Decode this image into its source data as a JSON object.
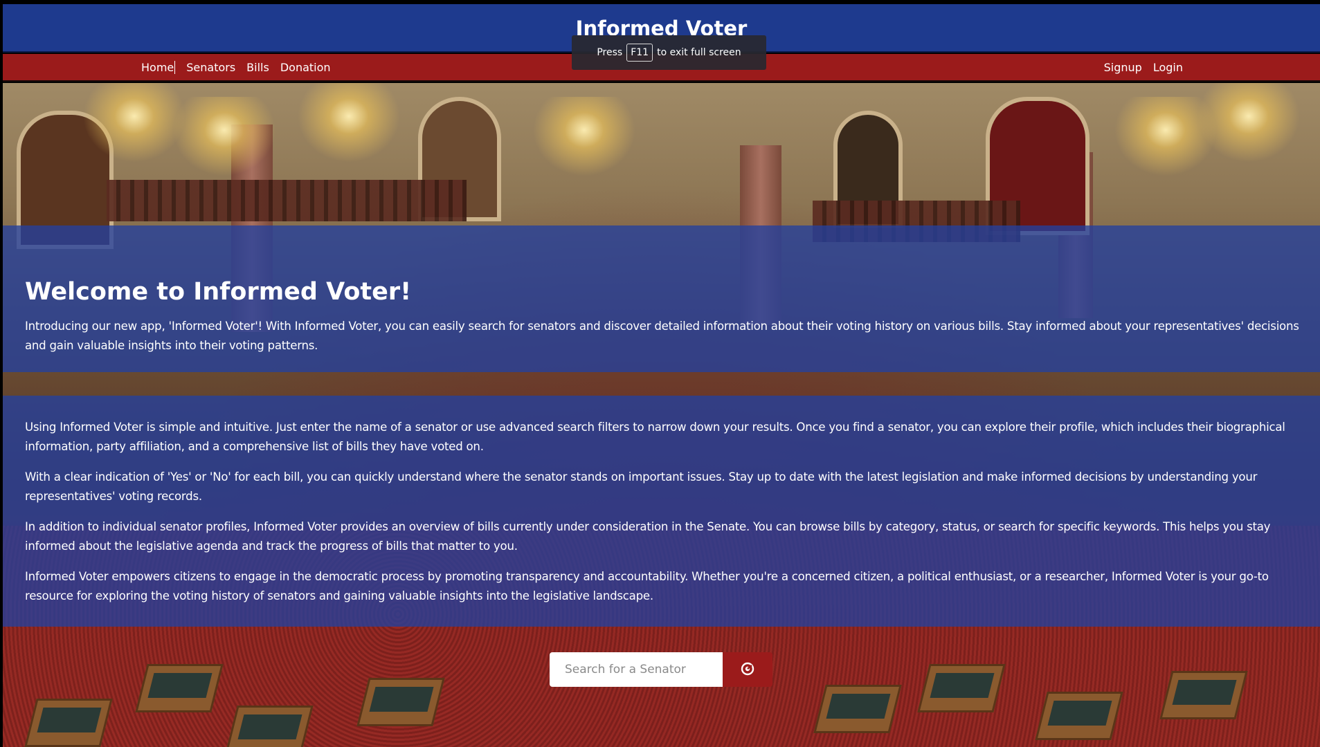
{
  "header": {
    "title": "Informed Voter"
  },
  "nav": {
    "left": [
      "Home",
      "Senators",
      "Bills",
      "Donation"
    ],
    "right": [
      "Signup",
      "Login"
    ]
  },
  "toast": {
    "prefix": "Press",
    "key": "F11",
    "suffix": "to exit full screen"
  },
  "welcome": {
    "heading": "Welcome to Informed Voter!",
    "intro": "Introducing our new app, 'Informed Voter'! With Informed Voter, you can easily search for senators and discover detailed information about their voting history on various bills. Stay informed about your representatives' decisions and gain valuable insights into their voting patterns."
  },
  "details": [
    "Using Informed Voter is simple and intuitive. Just enter the name of a senator or use advanced search filters to narrow down your results. Once you find a senator, you can explore their profile, which includes their biographical information, party affiliation, and a comprehensive list of bills they have voted on.",
    "With a clear indication of 'Yes' or 'No' for each bill, you can quickly understand where the senator stands on important issues. Stay up to date with the latest legislation and make informed decisions by understanding your representatives' voting records.",
    "In addition to individual senator profiles, Informed Voter provides an overview of bills currently under consideration in the Senate. You can browse bills by category, status, or search for specific keywords. This helps you stay informed about the legislative agenda and track the progress of bills that matter to you.",
    "Informed Voter empowers citizens to engage in the democratic process by promoting transparency and accountability. Whether you're a concerned citizen, a political enthusiast, or a researcher, Informed Voter is your go-to resource for exploring the voting history of senators and gaining valuable insights into the legislative landscape."
  ],
  "search": {
    "placeholder": "Search for a Senator",
    "icon": "search-icon"
  },
  "colors": {
    "header": "#1e3a8e",
    "nav": "#9b1b1b",
    "panel": "#24409e"
  }
}
